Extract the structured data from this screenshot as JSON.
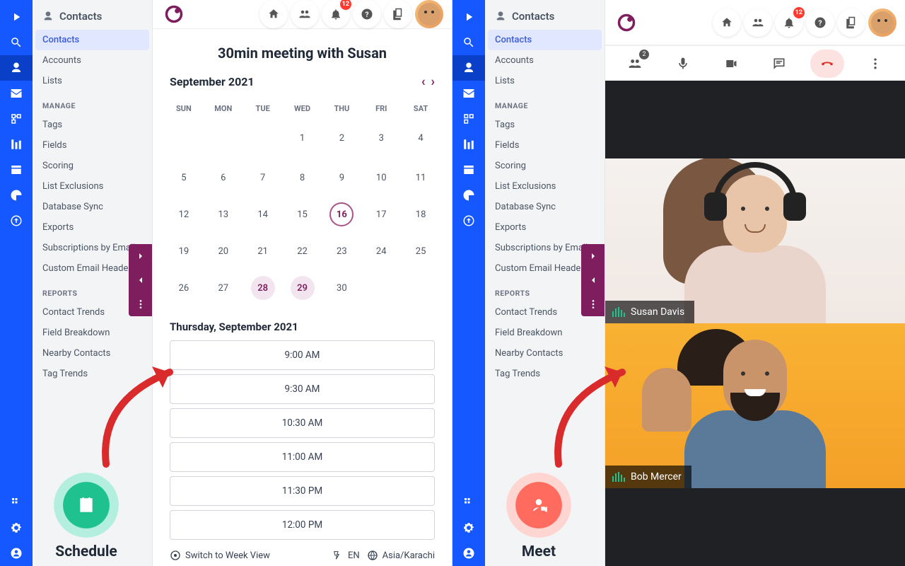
{
  "sidebar": {
    "header": "Contacts",
    "groups": [
      {
        "items": [
          "Contacts",
          "Accounts",
          "Lists"
        ]
      },
      {
        "heading": "MANAGE",
        "items": [
          "Tags",
          "Fields",
          "Scoring",
          "List Exclusions",
          "Database Sync",
          "Exports",
          "Subscriptions by Email",
          "Custom Email Headers"
        ]
      },
      {
        "heading": "REPORTS",
        "items": [
          "Contact Trends",
          "Field Breakdown",
          "Nearby Contacts",
          "Tag Trends"
        ]
      }
    ]
  },
  "topbar": {
    "notif_badge": "12"
  },
  "schedule": {
    "title": "30min meeting with Susan",
    "month": "September 2021",
    "dow": [
      "SUN",
      "MON",
      "TUE",
      "WED",
      "THU",
      "FRI",
      "SAT"
    ],
    "weeks": [
      [
        "",
        "",
        "",
        "1",
        "2",
        "3",
        "4"
      ],
      [
        "5",
        "6",
        "7",
        "8",
        "9",
        "10",
        "11"
      ],
      [
        "12",
        "13",
        "14",
        "15",
        "16",
        "17",
        "18"
      ],
      [
        "19",
        "20",
        "21",
        "22",
        "23",
        "24",
        "25"
      ],
      [
        "26",
        "27",
        "28",
        "29",
        "30",
        "",
        ""
      ]
    ],
    "selected_day": "16",
    "hl_days": [
      "28",
      "29"
    ],
    "date_label": "Thursday, September 2021",
    "slots": [
      "9:00 AM",
      "9:30 AM",
      "10:30 AM",
      "11:00 AM",
      "11:30 PM",
      "12:00 PM"
    ],
    "footer": {
      "switch": "Switch to Week View",
      "lang": "EN",
      "tz": "Asia/Karachi"
    },
    "action_label": "Schedule"
  },
  "meet": {
    "participants_badge": "2",
    "names": {
      "susan": "Susan Davis",
      "bob": "Bob Mercer"
    },
    "action_label": "Meet"
  }
}
